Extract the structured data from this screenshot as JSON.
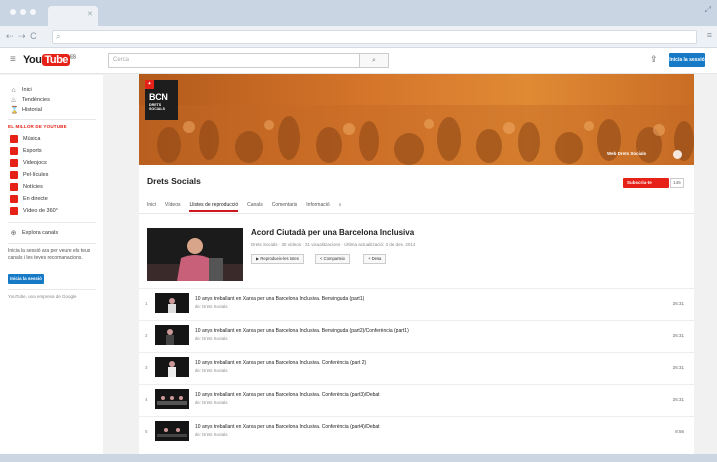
{
  "browser": {
    "controls": "⇠ ⇢ C"
  },
  "header": {
    "logo_you": "You",
    "logo_tube": "Tube",
    "logo_suffix": "ES",
    "search_placeholder": "Cerca",
    "signin_label": "Inicia la sessió"
  },
  "sidebar": {
    "nav": [
      {
        "label": "Inici",
        "icon": "home-icon"
      },
      {
        "label": "Tendències",
        "icon": "trending-icon"
      },
      {
        "label": "Historial",
        "icon": "history-icon"
      }
    ],
    "section_title": "EL MILLOR DE YOUTUBE",
    "best": [
      {
        "label": "Música"
      },
      {
        "label": "Esports"
      },
      {
        "label": "Videojocs"
      },
      {
        "label": "Pel·lícules"
      },
      {
        "label": "Notícies"
      },
      {
        "label": "En directe"
      },
      {
        "label": "Vídeo de 360°"
      }
    ],
    "browse_channels": "Explora canals",
    "signin_prompt": "Inicia la sessió ara per veure els teus canals i les teves recomanacions.",
    "signin_button": "Inicia la sessió",
    "footer_note": "YouTube, una empresa de Google"
  },
  "channel": {
    "badge_title": "BCN",
    "badge_subtitle": "DRETS SOCIALS",
    "banner_link": "Web Drets Socials",
    "name": "Drets Socials",
    "subscribe_label": "Subscriu-te",
    "subscriber_count": "145",
    "tabs": [
      "Inici",
      "Vídeos",
      "Llistes de reproducció",
      "Canals",
      "Comentaris",
      "Informació"
    ],
    "active_tab": "Llistes de reproducció"
  },
  "playlist": {
    "title": "Acord Ciutadà per una Barcelona Inclusiva",
    "meta": "Drets Socials · 35 vídeos · 31 visualitzacions · Última actualització: 3 de des. 2014",
    "play_all": "Reprodueix-les totes",
    "share": "Comparteix",
    "save": "Desa",
    "items": [
      {
        "num": "1",
        "title": "10 anys treballant en Xarxa per una Barcelona Inclusiva. Benvinguda (part1)",
        "by": "de: Drets Socials",
        "duration": "26:31"
      },
      {
        "num": "2",
        "title": "10 anys treballant en Xarxa per una Barcelona Inclusiva. Benvinguda (part2)/Conferència (part1)",
        "by": "de: Drets Socials",
        "duration": "26:31"
      },
      {
        "num": "3",
        "title": "10 anys treballant en Xarxa per una Barcelona Inclusiva. Conferència (part 2)",
        "by": "de: Drets Socials",
        "duration": "26:31"
      },
      {
        "num": "4",
        "title": "10 anys treballant en Xarxa per una Barcelona Inclusiva. Conferència (part3)/Debat",
        "by": "de: Drets Socials",
        "duration": "26:31"
      },
      {
        "num": "5",
        "title": "10 anys treballant en Xarxa per una Barcelona Inclusiva. Conferència (part4)/Debat",
        "by": "de: Drets Socials",
        "duration": "8:56"
      }
    ]
  }
}
